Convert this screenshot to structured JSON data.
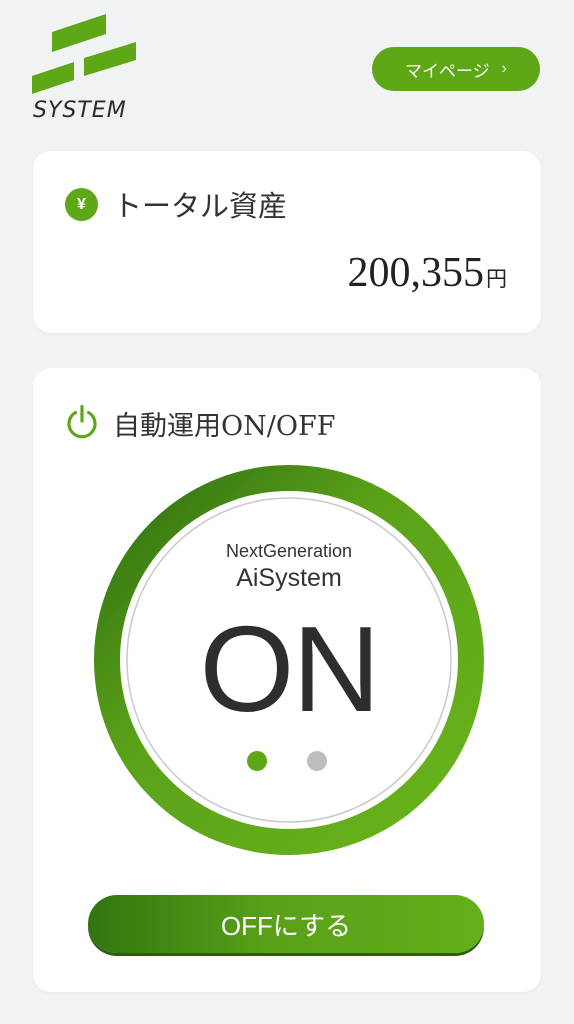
{
  "header": {
    "logo_text": "SYSTEM",
    "logo_icon": "system-logo-icon",
    "mypage_label": "マイページ",
    "mypage_chevron": "›"
  },
  "asset": {
    "icon_glyph": "¥",
    "icon": "yen-icon",
    "title": "トータル資産",
    "value": "200,355",
    "unit": "円"
  },
  "auto": {
    "icon": "power-icon",
    "title": "自動運用ON/OFF",
    "subtitle": "NextGeneration",
    "system_name": "AiSystem",
    "state": "ON",
    "pager": {
      "count": 2,
      "active": 1
    },
    "toggle_label": "OFFにする"
  },
  "colors": {
    "accent": "#5ea716",
    "accent_dark": "#327510",
    "background": "#f1f2f4",
    "card": "#ffffff",
    "inactive_dot": "#bdbdbd"
  }
}
